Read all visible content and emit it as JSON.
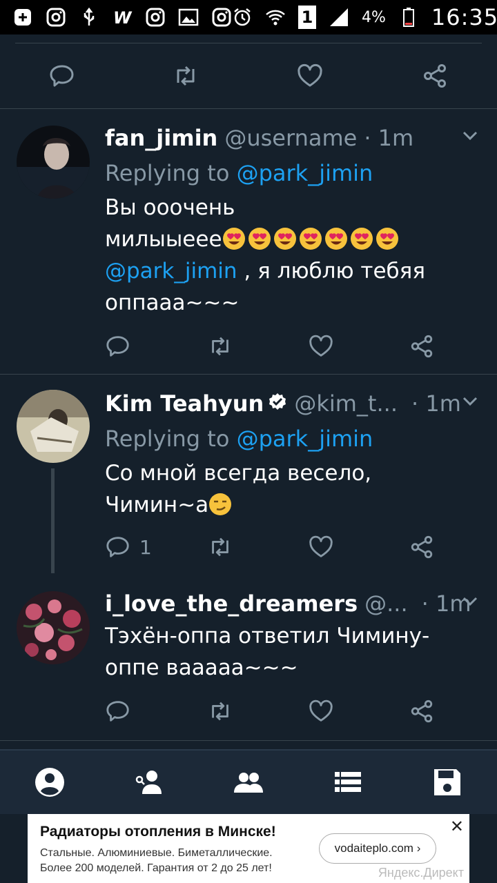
{
  "status_bar": {
    "battery_percent": "4%",
    "time": "16:35",
    "sim": "1"
  },
  "tweets": [
    {
      "name": "fan_jimin",
      "handle": "@username",
      "time": "· 1m",
      "replying_prefix": "Replying to",
      "replying_to": "@park_jimin",
      "text_line1": "Вы ооочень",
      "text_line2": "милыыеее",
      "emoji_count": 7,
      "mention": "@park_jimin",
      "text_line3_rest": " , я люблю тебяя",
      "text_line4": "оппааа~~~",
      "reply_count": ""
    },
    {
      "name": "Kim Teahyun",
      "handle": "@kim_t...",
      "time": "· 1m",
      "verified": true,
      "replying_prefix": "Replying to",
      "replying_to": "@park_jimin",
      "text_line1": "Со мной всегда весело,",
      "text_line2": "Чимин~а",
      "reply_count": "1"
    },
    {
      "name": "i_love_the_dreamers",
      "handle": "@...",
      "time": "· 1m",
      "text_line1": "Тэхён-оппа ответил Чимину-",
      "text_line2": "оппе вааааа~~~",
      "reply_count": ""
    }
  ],
  "icons": {
    "reply": "reply-icon",
    "retweet": "retweet-icon",
    "like": "heart-icon",
    "share": "share-icon",
    "chevron": "chevron-down-icon"
  },
  "bottom_nav": [
    "profile-icon",
    "add-user-icon",
    "people-icon",
    "list-icon",
    "save-icon"
  ],
  "ad": {
    "title": "Радиаторы отопления в Минске!",
    "desc_line1": "Стальные. Алюминиевые. Биметаллические.",
    "desc_line2": "Более 200 моделей. Гарантия от 2 до 25 лет!",
    "button": "vodaiteplo.com ›",
    "close": "✕",
    "source": "Яндекс.Директ"
  },
  "colors": {
    "background": "#15202b",
    "accent": "#1da1f2",
    "muted": "#8899a6",
    "separator": "#38444d"
  }
}
